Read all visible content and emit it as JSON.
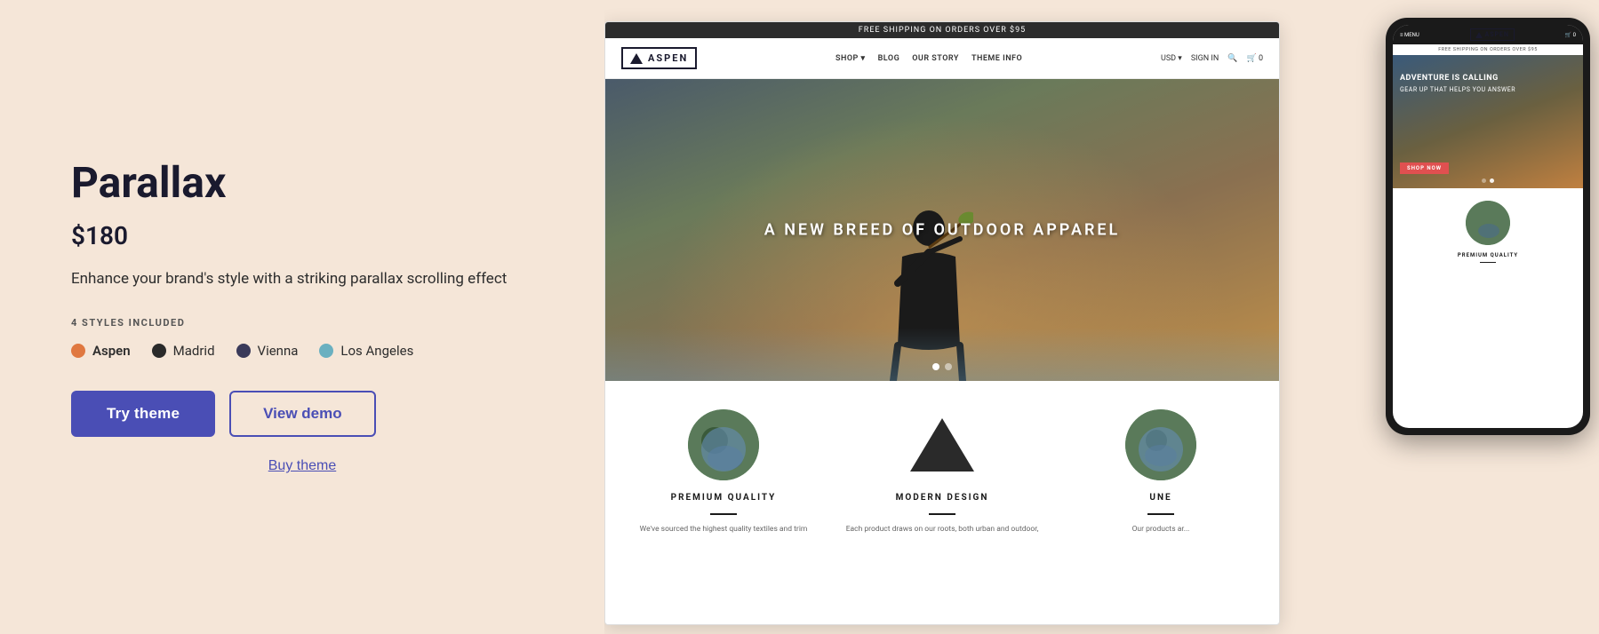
{
  "left": {
    "title": "Parallax",
    "price": "$180",
    "description": "Enhance your brand's style with a striking parallax scrolling effect",
    "styles_label": "4 STYLES INCLUDED",
    "styles": [
      {
        "name": "Aspen",
        "color": "#e07840",
        "selected": true
      },
      {
        "name": "Madrid",
        "color": "#2a2a2a",
        "selected": false
      },
      {
        "name": "Vienna",
        "color": "#3a3a5a",
        "selected": false
      },
      {
        "name": "Los Angeles",
        "color": "#6ab0c0",
        "selected": false
      }
    ],
    "try_button": "Try theme",
    "demo_button": "View demo",
    "buy_link": "Buy theme"
  },
  "desktop_preview": {
    "shipping_bar": "FREE SHIPPING ON ORDERS OVER $95",
    "logo": "ASPEN",
    "nav_links": [
      "SHOP ▾",
      "BLOG",
      "OUR STORY",
      "THEME INFO"
    ],
    "nav_right": [
      "USD ▾",
      "SIGN IN",
      "🔍",
      "🛒 0"
    ],
    "hero_text": "A NEW BREED OF OUTDOOR APPAREL",
    "features": [
      {
        "title": "PREMIUM QUALITY",
        "text": "We've sourced the highest quality textiles and trim"
      },
      {
        "title": "MODERN DESIGN",
        "text": "Each product draws on our roots, both urban and outdoor,"
      },
      {
        "title": "UNE...",
        "text": "Our products ar..."
      }
    ]
  },
  "mobile_preview": {
    "shipping_bar": "FREE SHIPPING ON ORDERS OVER $95",
    "logo": "ASPEN",
    "hero_title": "ADVENTURE IS CALLING",
    "hero_subtitle": "GEAR UP THAT HELPS YOU ANSWER",
    "shop_btn": "SHOP NOW",
    "feature_title": "PREMIUM QUALITY"
  }
}
